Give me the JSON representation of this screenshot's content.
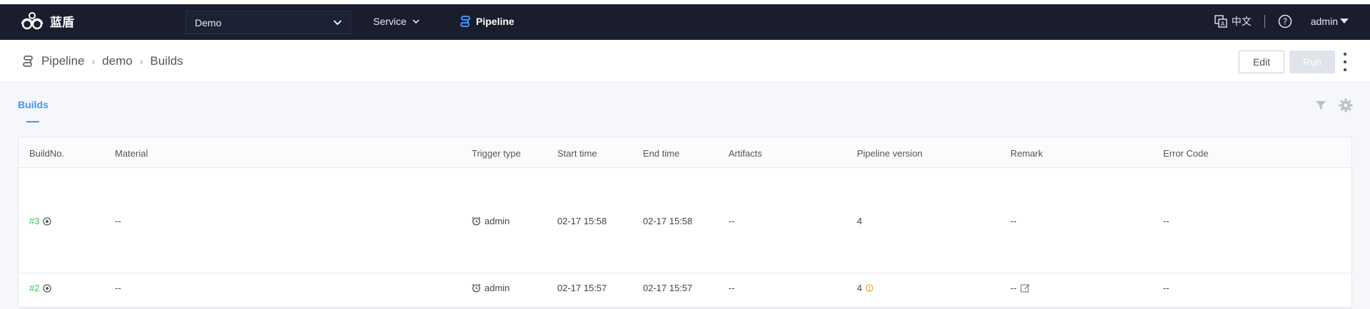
{
  "app": {
    "logo_text": "蓝盾"
  },
  "topnav": {
    "project": "Demo",
    "service_label": "Service",
    "pipeline_label": "Pipeline",
    "lang_label": "中文",
    "user": "admin"
  },
  "breadcrumb": [
    "Pipeline",
    "demo",
    "Builds"
  ],
  "actions": {
    "edit": "Edit",
    "run": "Run"
  },
  "tabs": {
    "builds": "Builds"
  },
  "table": {
    "columns": [
      "BuildNo.",
      "Material",
      "Trigger type",
      "Start time",
      "End time",
      "Artifacts",
      "Pipeline version",
      "Remark",
      "Error Code"
    ],
    "rows": [
      {
        "build_no": "#3",
        "material": "--",
        "trigger": "admin",
        "start": "02-17 15:58",
        "end": "02-17 15:58",
        "artifacts": "--",
        "version": "4",
        "remark": "--",
        "error_code": "--"
      },
      {
        "build_no": "#2",
        "material": "--",
        "trigger": "admin",
        "start": "02-17 15:57",
        "end": "02-17 15:57",
        "artifacts": "--",
        "version": "4",
        "remark": "--",
        "error_code": "--"
      }
    ]
  },
  "colors": {
    "accent": "#3c96ff",
    "success": "#2dcb56",
    "warning": "#ff9c01",
    "topbar": "#1a1d2e"
  }
}
